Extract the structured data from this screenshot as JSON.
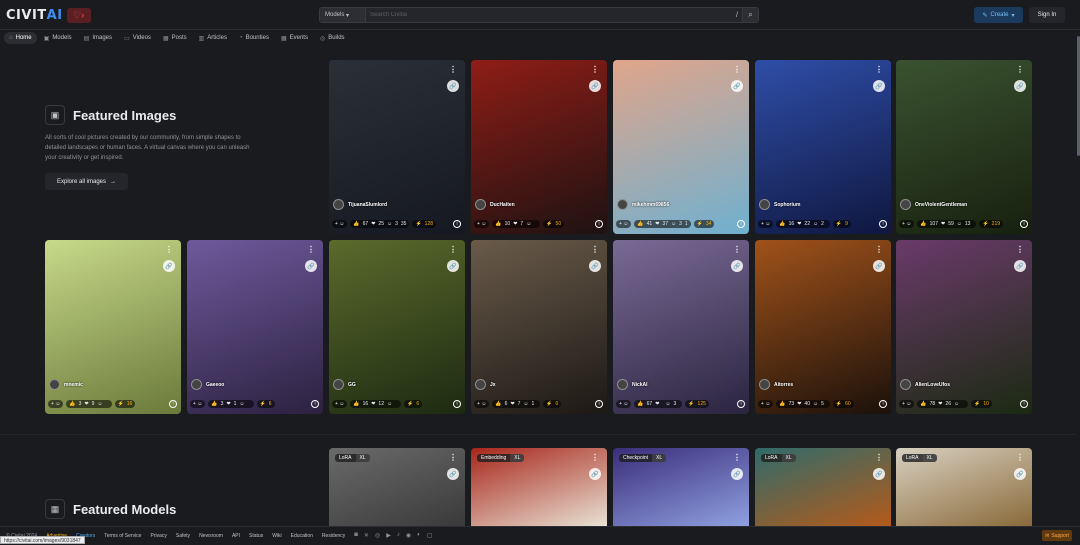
{
  "header": {
    "logo_prefix": "CIVIT",
    "logo_suffix": "AI",
    "search_scope": "Models",
    "search_placeholder": "Search Civitai",
    "search_shortcut": "/",
    "create_label": "Create",
    "signin_label": "Sign In"
  },
  "nav": {
    "items": [
      {
        "label": "Home",
        "icon": "home-icon"
      },
      {
        "label": "Models",
        "icon": "cube-icon"
      },
      {
        "label": "Images",
        "icon": "photo-icon"
      },
      {
        "label": "Videos",
        "icon": "video-icon"
      },
      {
        "label": "Posts",
        "icon": "posts-icon"
      },
      {
        "label": "Articles",
        "icon": "article-icon"
      },
      {
        "label": "Bounties",
        "icon": "moneybag-icon"
      },
      {
        "label": "Events",
        "icon": "calendar-icon"
      },
      {
        "label": "Builds",
        "icon": "cpu-icon"
      }
    ]
  },
  "featured_images": {
    "title": "Featured Images",
    "description": "All sorts of cool pictures created by our community, from simple shapes to detailed landscapes or human faces. A virtual canvas where you can unleash your creativity or get inspired.",
    "explore_label": "Explore all images"
  },
  "cards": [
    {
      "user": "TijuanaSlumlord",
      "likes": "67",
      "hearts": "25",
      "laughs": "3",
      "cries": "35",
      "buzz": "128",
      "colors": [
        "#2b3038",
        "#151820"
      ]
    },
    {
      "user": "DucHaiten",
      "likes": "10",
      "hearts": "7",
      "laughs": "",
      "cries": "",
      "buzz": "50",
      "colors": [
        "#8f1d16",
        "#1d1212"
      ]
    },
    {
      "user": "mikehmm69856",
      "likes": "41",
      "hearts": "37",
      "laughs": "3",
      "cries": "1",
      "buzz": "34",
      "colors": [
        "#e0a58a",
        "#6fb0d0"
      ]
    },
    {
      "user": "Sophorium",
      "likes": "16",
      "hearts": "22",
      "laughs": "2",
      "cries": "",
      "buzz": "9",
      "colors": [
        "#2f4ea8",
        "#0f1740"
      ]
    },
    {
      "user": "OneViolentGentleman",
      "likes": "107",
      "hearts": "59",
      "laughs": "13",
      "cries": "",
      "buzz": "219",
      "colors": [
        "#3a5230",
        "#17200f"
      ]
    },
    {
      "user": "mnemic",
      "likes": "3",
      "hearts": "9",
      "laughs": "",
      "cries": "",
      "buzz": "16",
      "colors": [
        "#c7d98a",
        "#6b7a3a"
      ]
    },
    {
      "user": "Gaeeoo",
      "likes": "3",
      "hearts": "1",
      "laughs": "",
      "cries": "",
      "buzz": "6",
      "colors": [
        "#6d5a9c",
        "#2c2140"
      ]
    },
    {
      "user": "GG",
      "likes": "16",
      "hearts": "12",
      "laughs": "",
      "cries": "",
      "buzz": "6",
      "colors": [
        "#5b6a2c",
        "#1d2a12"
      ]
    },
    {
      "user": "Jx",
      "likes": "6",
      "hearts": "7",
      "laughs": "1",
      "cries": "",
      "buzz": "0",
      "colors": [
        "#6a5b4a",
        "#1c1815"
      ]
    },
    {
      "user": "NickAI",
      "likes": "67",
      "hearts": "",
      "laughs": "3",
      "cries": "",
      "buzz": "125",
      "colors": [
        "#7a6a96",
        "#2b2540"
      ]
    },
    {
      "user": "Aitorres",
      "likes": "73",
      "hearts": "40",
      "laughs": "5",
      "cries": "",
      "buzz": "60",
      "colors": [
        "#a0521a",
        "#1b110b"
      ]
    },
    {
      "user": "AlienLoveUfos",
      "likes": "78",
      "hearts": "26",
      "laughs": "",
      "cries": "",
      "buzz": "10",
      "colors": [
        "#6a3a6a",
        "#1b2a12"
      ]
    }
  ],
  "featured_models": {
    "title": "Featured Models",
    "cards": [
      {
        "tag1": "LoRA",
        "tag2": "XL",
        "colors": [
          "#6a6a6a",
          "#3a3a3a"
        ]
      },
      {
        "tag1": "Embedding",
        "tag2": "XL",
        "colors": [
          "#a8251a",
          "#e8e2d4"
        ]
      },
      {
        "tag1": "Checkpoint",
        "tag2": "XL",
        "colors": [
          "#3a2d7a",
          "#8fa0e0"
        ]
      },
      {
        "tag1": "LoRA",
        "tag2": "XL",
        "colors": [
          "#2f6b6b",
          "#b45a1a"
        ]
      },
      {
        "tag1": "LoRA",
        "tag2": "XL",
        "colors": [
          "#d8d0c0",
          "#8a6a3a"
        ]
      }
    ]
  },
  "footer": {
    "copyright": "© Civitai 2024",
    "links": [
      "Advertise",
      "Creators",
      "Terms of Service",
      "Privacy",
      "Safety",
      "Newsroom",
      "API",
      "Status",
      "Wiki",
      "Education",
      "Residency"
    ],
    "support_label": "Support",
    "status_url": "https://civitai.com/images/9031847"
  },
  "accent_color": "#228be6"
}
